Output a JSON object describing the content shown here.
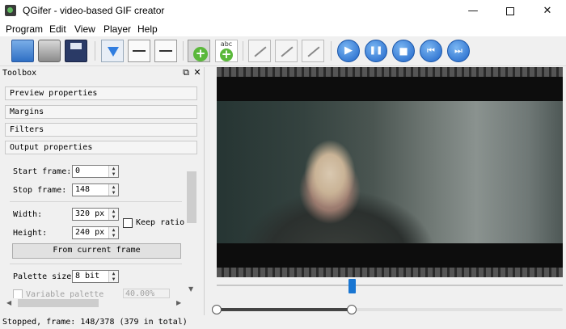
{
  "window": {
    "title": "QGifer - video-based GIF creator",
    "minimize_glyph": "—",
    "close_glyph": "✕"
  },
  "menu": {
    "items": [
      {
        "label": "Program"
      },
      {
        "label": "Edit"
      },
      {
        "label": "View"
      },
      {
        "label": "Player"
      },
      {
        "label": "Help"
      }
    ]
  },
  "toolbar": {
    "buttons": [
      {
        "icon": "open-folder-icon"
      },
      {
        "icon": "scanner-icon"
      },
      {
        "icon": "save-icon"
      },
      {
        "icon": "extract-gif-icon"
      },
      {
        "icon": "set-start-icon"
      },
      {
        "icon": "set-stop-icon"
      },
      {
        "icon": "add-object-icon"
      },
      {
        "icon": "add-text-icon",
        "text": "abc"
      },
      {
        "icon": "edit-object-icon"
      },
      {
        "icon": "edit-all-icon"
      },
      {
        "icon": "export-icon"
      },
      {
        "icon": "play-icon",
        "glyph": "▶"
      },
      {
        "icon": "pause-icon",
        "glyph": "❚❚"
      },
      {
        "icon": "stop-icon",
        "glyph": "■"
      },
      {
        "icon": "previous-icon",
        "glyph": "⏮"
      },
      {
        "icon": "next-icon",
        "glyph": "⏭"
      }
    ]
  },
  "toolbox": {
    "title": "Toolbox",
    "float_glyph": "⧉",
    "close_glyph": "✕",
    "sections": [
      {
        "label": "Preview properties"
      },
      {
        "label": "Margins"
      },
      {
        "label": "Filters"
      },
      {
        "label": "Output properties"
      }
    ],
    "start_frame": {
      "label": "Start frame:",
      "value": "0"
    },
    "stop_frame": {
      "label": "Stop frame:",
      "value": "148"
    },
    "width": {
      "label": "Width:",
      "value": "320 px"
    },
    "height": {
      "label": "Height:",
      "value": "240 px"
    },
    "keep_ratio": {
      "label": "Keep ratio",
      "checked": false
    },
    "from_current_frame": "From current frame",
    "palette_size": {
      "label": "Palette size:",
      "value": "8 bit"
    },
    "variable_palette": {
      "label": "Variable palette",
      "checked": false,
      "value": "40.00%"
    }
  },
  "player": {
    "frame_position": 0.39,
    "range_start": 0.0,
    "range_end": 0.39
  },
  "status": {
    "text": "Stopped, frame: 148/378 (379 in total)"
  },
  "colors": {
    "accent": "#1976d2",
    "play_blue": "#1e64c8"
  }
}
